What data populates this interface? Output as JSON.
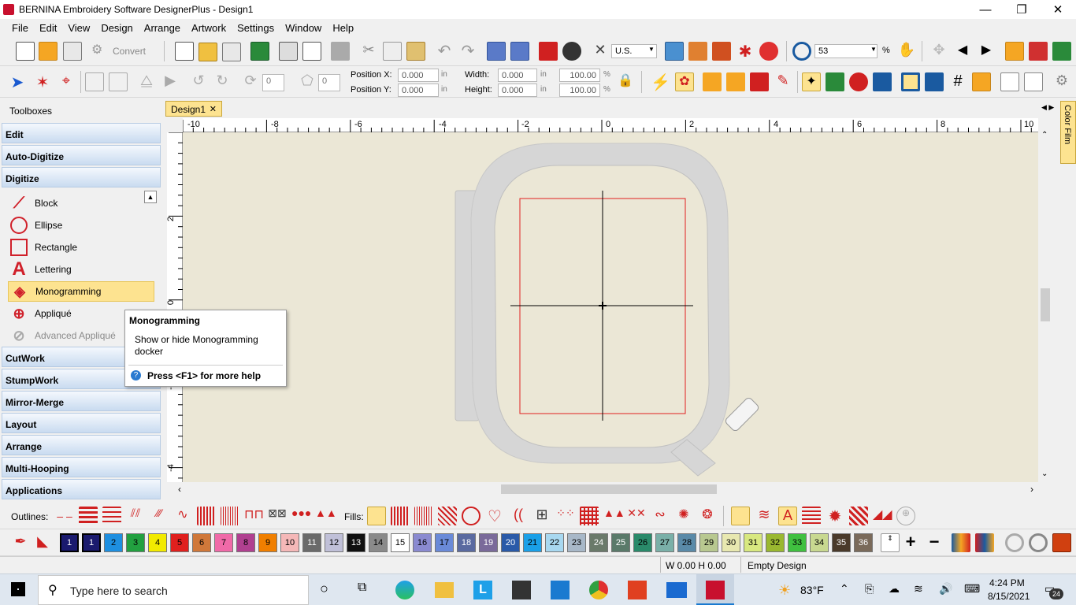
{
  "titlebar": {
    "title": "BERNINA Embroidery Software DesignerPlus - Design1",
    "min": "—",
    "max": "❐",
    "close": "✕"
  },
  "menu": [
    "File",
    "Edit",
    "View",
    "Design",
    "Arrange",
    "Artwork",
    "Settings",
    "Window",
    "Help"
  ],
  "toolbar1": {
    "convert": "Convert",
    "units": "U.S.",
    "zoom": "53",
    "zoom_unit": "%"
  },
  "toolbar2": {
    "angle1": "0",
    "angle2": "0",
    "pos_x_label": "Position X:",
    "pos_y_label": "Position Y:",
    "pos_x": "0.000",
    "pos_y": "0.000",
    "width_label": "Width:",
    "height_label": "Height:",
    "width": "0.000",
    "height": "0.000",
    "unit": "in",
    "scale_w": "100.00",
    "scale_h": "100.00",
    "pct": "%"
  },
  "toolbox": {
    "header": "Toolboxes",
    "top_categories": [
      "Edit",
      "Auto-Digitize",
      "Digitize"
    ],
    "digitize_items": [
      {
        "label": "Block"
      },
      {
        "label": "Ellipse"
      },
      {
        "label": "Rectangle"
      },
      {
        "label": "Lettering"
      },
      {
        "label": "Monogramming"
      },
      {
        "label": "Appliqué"
      },
      {
        "label": "Advanced Appliqué"
      }
    ],
    "bottom_categories": [
      "CutWork",
      "StumpWork",
      "Mirror-Merge",
      "Layout",
      "Arrange",
      "Multi-Hooping",
      "Applications"
    ]
  },
  "tooltip": {
    "title": "Monogramming",
    "body": "Show or hide Monogramming docker",
    "help": "Press <F1> for more help"
  },
  "document": {
    "tab": "Design1",
    "close": "✕",
    "side_tab": "Color Film"
  },
  "ruler": {
    "h_ticks": [
      "-10",
      "-8",
      "-6",
      "-4",
      "-2",
      "0",
      "2",
      "4",
      "6",
      "8",
      "10"
    ],
    "v_ticks": [
      "2",
      "0",
      "-2",
      "-4"
    ]
  },
  "bottom_toolbar": {
    "outlines_label": "Outlines:",
    "fills_label": "Fills:"
  },
  "palette": {
    "swatches": [
      {
        "n": "1",
        "c": "#1a1a6e"
      },
      {
        "n": "1",
        "c": "#1a1a6e"
      },
      {
        "n": "2",
        "c": "#1e8fe0"
      },
      {
        "n": "3",
        "c": "#22a040"
      },
      {
        "n": "4",
        "c": "#f2ea00"
      },
      {
        "n": "5",
        "c": "#e0201e"
      },
      {
        "n": "6",
        "c": "#d0783a"
      },
      {
        "n": "7",
        "c": "#f06aa8"
      },
      {
        "n": "8",
        "c": "#b04090"
      },
      {
        "n": "9",
        "c": "#f07f00"
      },
      {
        "n": "10",
        "c": "#f5b8b8"
      },
      {
        "n": "11",
        "c": "#6a6a6a"
      },
      {
        "n": "12",
        "c": "#c0c0d8"
      },
      {
        "n": "13",
        "c": "#101010"
      },
      {
        "n": "14",
        "c": "#8a8a8a"
      },
      {
        "n": "15",
        "c": "#ffffff"
      },
      {
        "n": "16",
        "c": "#8a8ad0"
      },
      {
        "n": "17",
        "c": "#6a8ad8"
      },
      {
        "n": "18",
        "c": "#5a6aa0"
      },
      {
        "n": "19",
        "c": "#7a6a9a"
      },
      {
        "n": "20",
        "c": "#2a5aa8"
      },
      {
        "n": "21",
        "c": "#1aa0e8"
      },
      {
        "n": "22",
        "c": "#a8d8f0"
      },
      {
        "n": "23",
        "c": "#a8b8c8"
      },
      {
        "n": "24",
        "c": "#6a7a6a"
      },
      {
        "n": "25",
        "c": "#5a7a6a"
      },
      {
        "n": "26",
        "c": "#2a8a6a"
      },
      {
        "n": "27",
        "c": "#7ab0a8"
      },
      {
        "n": "28",
        "c": "#5a8aa8"
      },
      {
        "n": "29",
        "c": "#b8c890"
      },
      {
        "n": "30",
        "c": "#e8e8b0"
      },
      {
        "n": "31",
        "c": "#d8e880"
      },
      {
        "n": "32",
        "c": "#9ab830"
      },
      {
        "n": "33",
        "c": "#40c040"
      },
      {
        "n": "34",
        "c": "#c8d890"
      },
      {
        "n": "35",
        "c": "#4a3a2a"
      },
      {
        "n": "36",
        "c": "#7a6a5a"
      }
    ]
  },
  "status": {
    "size": "W 0.00 H 0.00",
    "state": "Empty Design"
  },
  "taskbar": {
    "search": "Type here to search",
    "weather": "83°F",
    "time": "4:24 PM",
    "date": "8/15/2021",
    "badge": "24"
  },
  "colors": {
    "accent": "#fde390",
    "toolbox_cat": "#c9dbf0",
    "canvas": "#ebe7d6",
    "hoop_red": "#e02020"
  }
}
